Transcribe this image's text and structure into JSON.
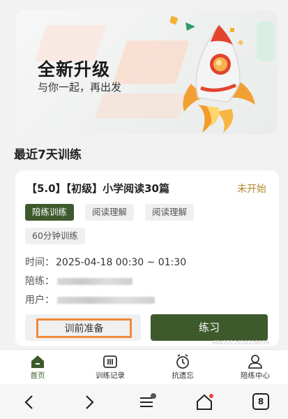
{
  "banner": {
    "title": "全新升级",
    "subtitle": "与你一起，再出发"
  },
  "section": {
    "title": "最近7天训练"
  },
  "card": {
    "course": "【5.0】【初级】小学阅读30篇",
    "status": "未开始",
    "tags": [
      "陪练训练",
      "阅读理解",
      "阅读理解",
      "60分钟训练"
    ],
    "time_label": "时间：",
    "time_value": "2025-04-18 00:30 ~ 01:30",
    "coach_label": "陪练：",
    "user_label": "用户：",
    "prep_button": "训前准备",
    "practice_button": "练习",
    "id_text": "6843211618318059"
  },
  "tabbar": {
    "items": [
      {
        "label": "首页",
        "icon": "home-icon"
      },
      {
        "label": "训练记录",
        "icon": "records-icon"
      },
      {
        "label": "抗遗忘",
        "icon": "clock-icon"
      },
      {
        "label": "陪练中心",
        "icon": "user-icon"
      }
    ]
  },
  "sysnav": {
    "tabs_count": "8"
  },
  "colors": {
    "accent": "#3d5a2c",
    "status": "#b08a2e",
    "highlight": "#f08a3a"
  }
}
